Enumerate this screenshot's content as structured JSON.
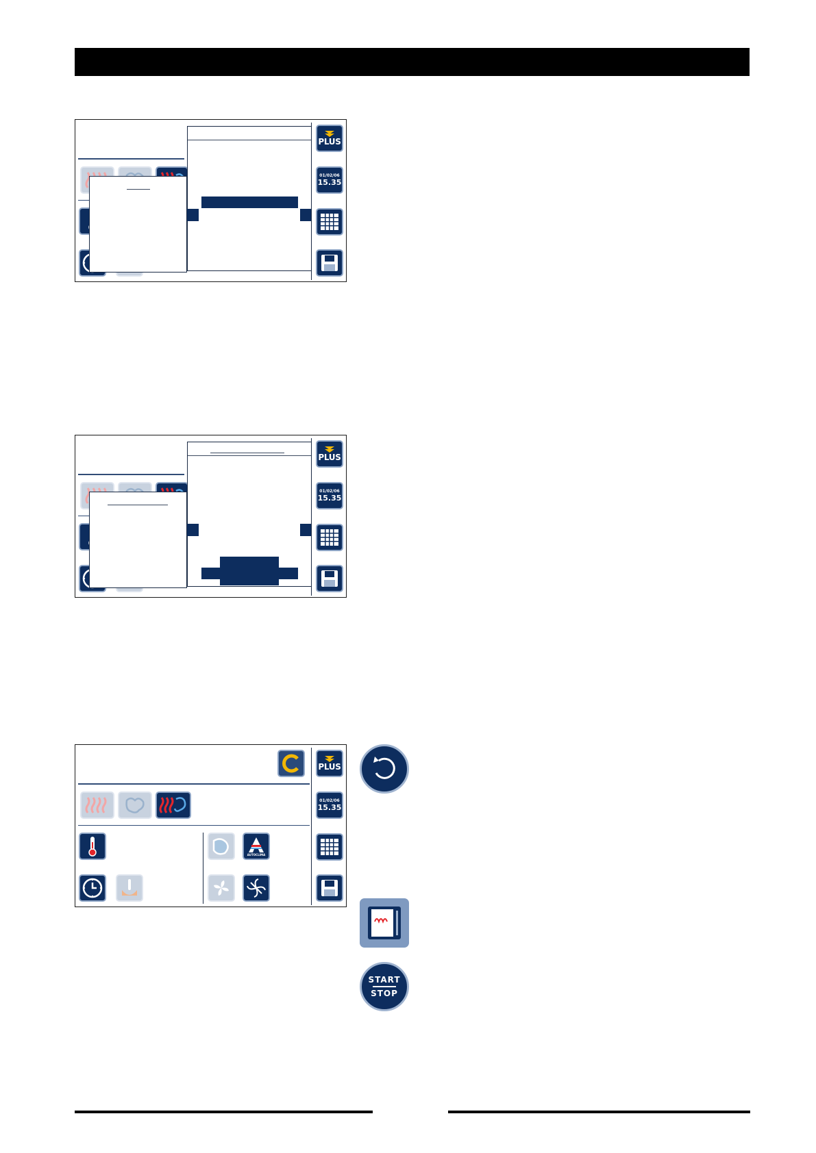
{
  "header": {
    "title": ""
  },
  "panel": {
    "plus_label": "PLUS",
    "date": "01/02/06",
    "time": "15.35",
    "autoclima_label": "AUTOCLIMA"
  },
  "icons": {
    "start_label": "START",
    "stop_label": "STOP"
  },
  "colors": {
    "navy": "#0d2d5e",
    "heat_red": "#e3262b",
    "accent_yellow": "#f2b705"
  }
}
